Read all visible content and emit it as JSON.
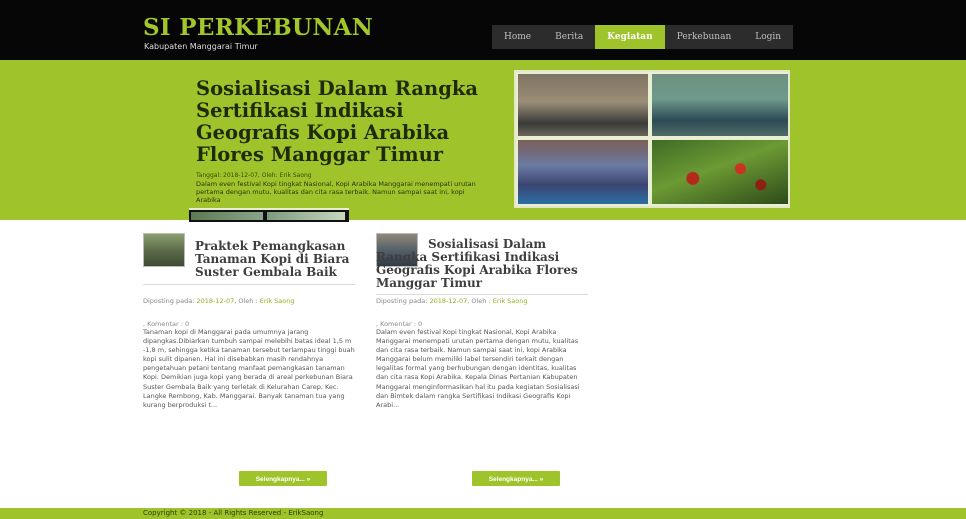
{
  "site": {
    "title": "SI PERKEBUNAN",
    "subtitle": "Kabupaten Manggarai Timur"
  },
  "nav": {
    "items": [
      {
        "label": "Home"
      },
      {
        "label": "Berita"
      },
      {
        "label": "Kegiatan",
        "active": true
      },
      {
        "label": "Perkebunan"
      },
      {
        "label": "Login"
      }
    ]
  },
  "hero": {
    "title": "Sosialisasi Dalam Rangka Sertifikasi Indikasi Geografis Kopi Arabika Flores Manggar Timur",
    "meta": "Tanggal: 2018-12-07, Oleh: Erik Saong",
    "excerpt": "Dalam even festival Kopi tingkat Nasional, Kopi Arabika Manggarai menempati urutan pertama dengan mutu, kualitas dan cita rasa terbaik. Namun sampai saat ini, kopi Arabika"
  },
  "posts": [
    {
      "title": "Praktek Pemangkasan Tanaman Kopi di Biara Suster Gembala Baik",
      "meta_prefix": "Diposting pada: ",
      "date": "2018-12-07",
      "by_prefix": ", Oleh : ",
      "author": "Erik Saong",
      "comments": ", Komentar : 0",
      "excerpt": "Tanaman kopi di Manggarai pada umumnya jarang dipangkas.Dibiarkan tumbuh sampai melebihi batas ideal 1,5 m -1,8 m, sehingga ketika tanaman tersebut terlampau tinggi buah kopi sulit dipanen. Hal ini disebabkan masih rendahnya pengetahuan petani tentang manfaat pemangkasan tanaman Kopi. Demikian juga kopi yang berada di areal perkebunan Biara Suster Gembala Baik yang terletak di Kelurahan Carep, Kec. Langke Rembong, Kab. Manggarai. Banyak tanaman tua yang kurang berproduksi t...",
      "button": "Selengkapnya... »"
    },
    {
      "title": "Sosialisasi Dalam Rangka Sertifikasi Indikasi Geografis Kopi Arabika Flores Manggar Timur",
      "meta_prefix": "Diposting pada: ",
      "date": "2018-12-07",
      "by_prefix": ", Oleh : ",
      "author": "Erik Saong",
      "comments": ", Komentar : 0",
      "excerpt": "Dalam even festival Kopi tingkat Nasional, Kopi Arabika Manggarai menempati urutan pertama dengan mutu, kualitas dan cita rasa terbaik. Namun sampai saat ini, kopi Arabika Manggarai belum memiliki label tersendiri terkait dengan legalitas formal yang berhubungan dengan identitas, kualitas dan cita rasa Kopi Arabika. Kepala Dinas Pertanian Kabupaten Manggarai menginformasikan hal itu pada kegiatan Sosialisasi dan Bimtek dalam rangka Sertifikasi Indikasi Geografis Kopi Arabi...",
      "button": "Selengkapnya... »"
    }
  ],
  "footer": {
    "text": "Copyright © 2018 - All Rights Reserved - ErikSaong"
  },
  "colors": {
    "accent": "#9fc42b",
    "topbar": "#060606"
  }
}
